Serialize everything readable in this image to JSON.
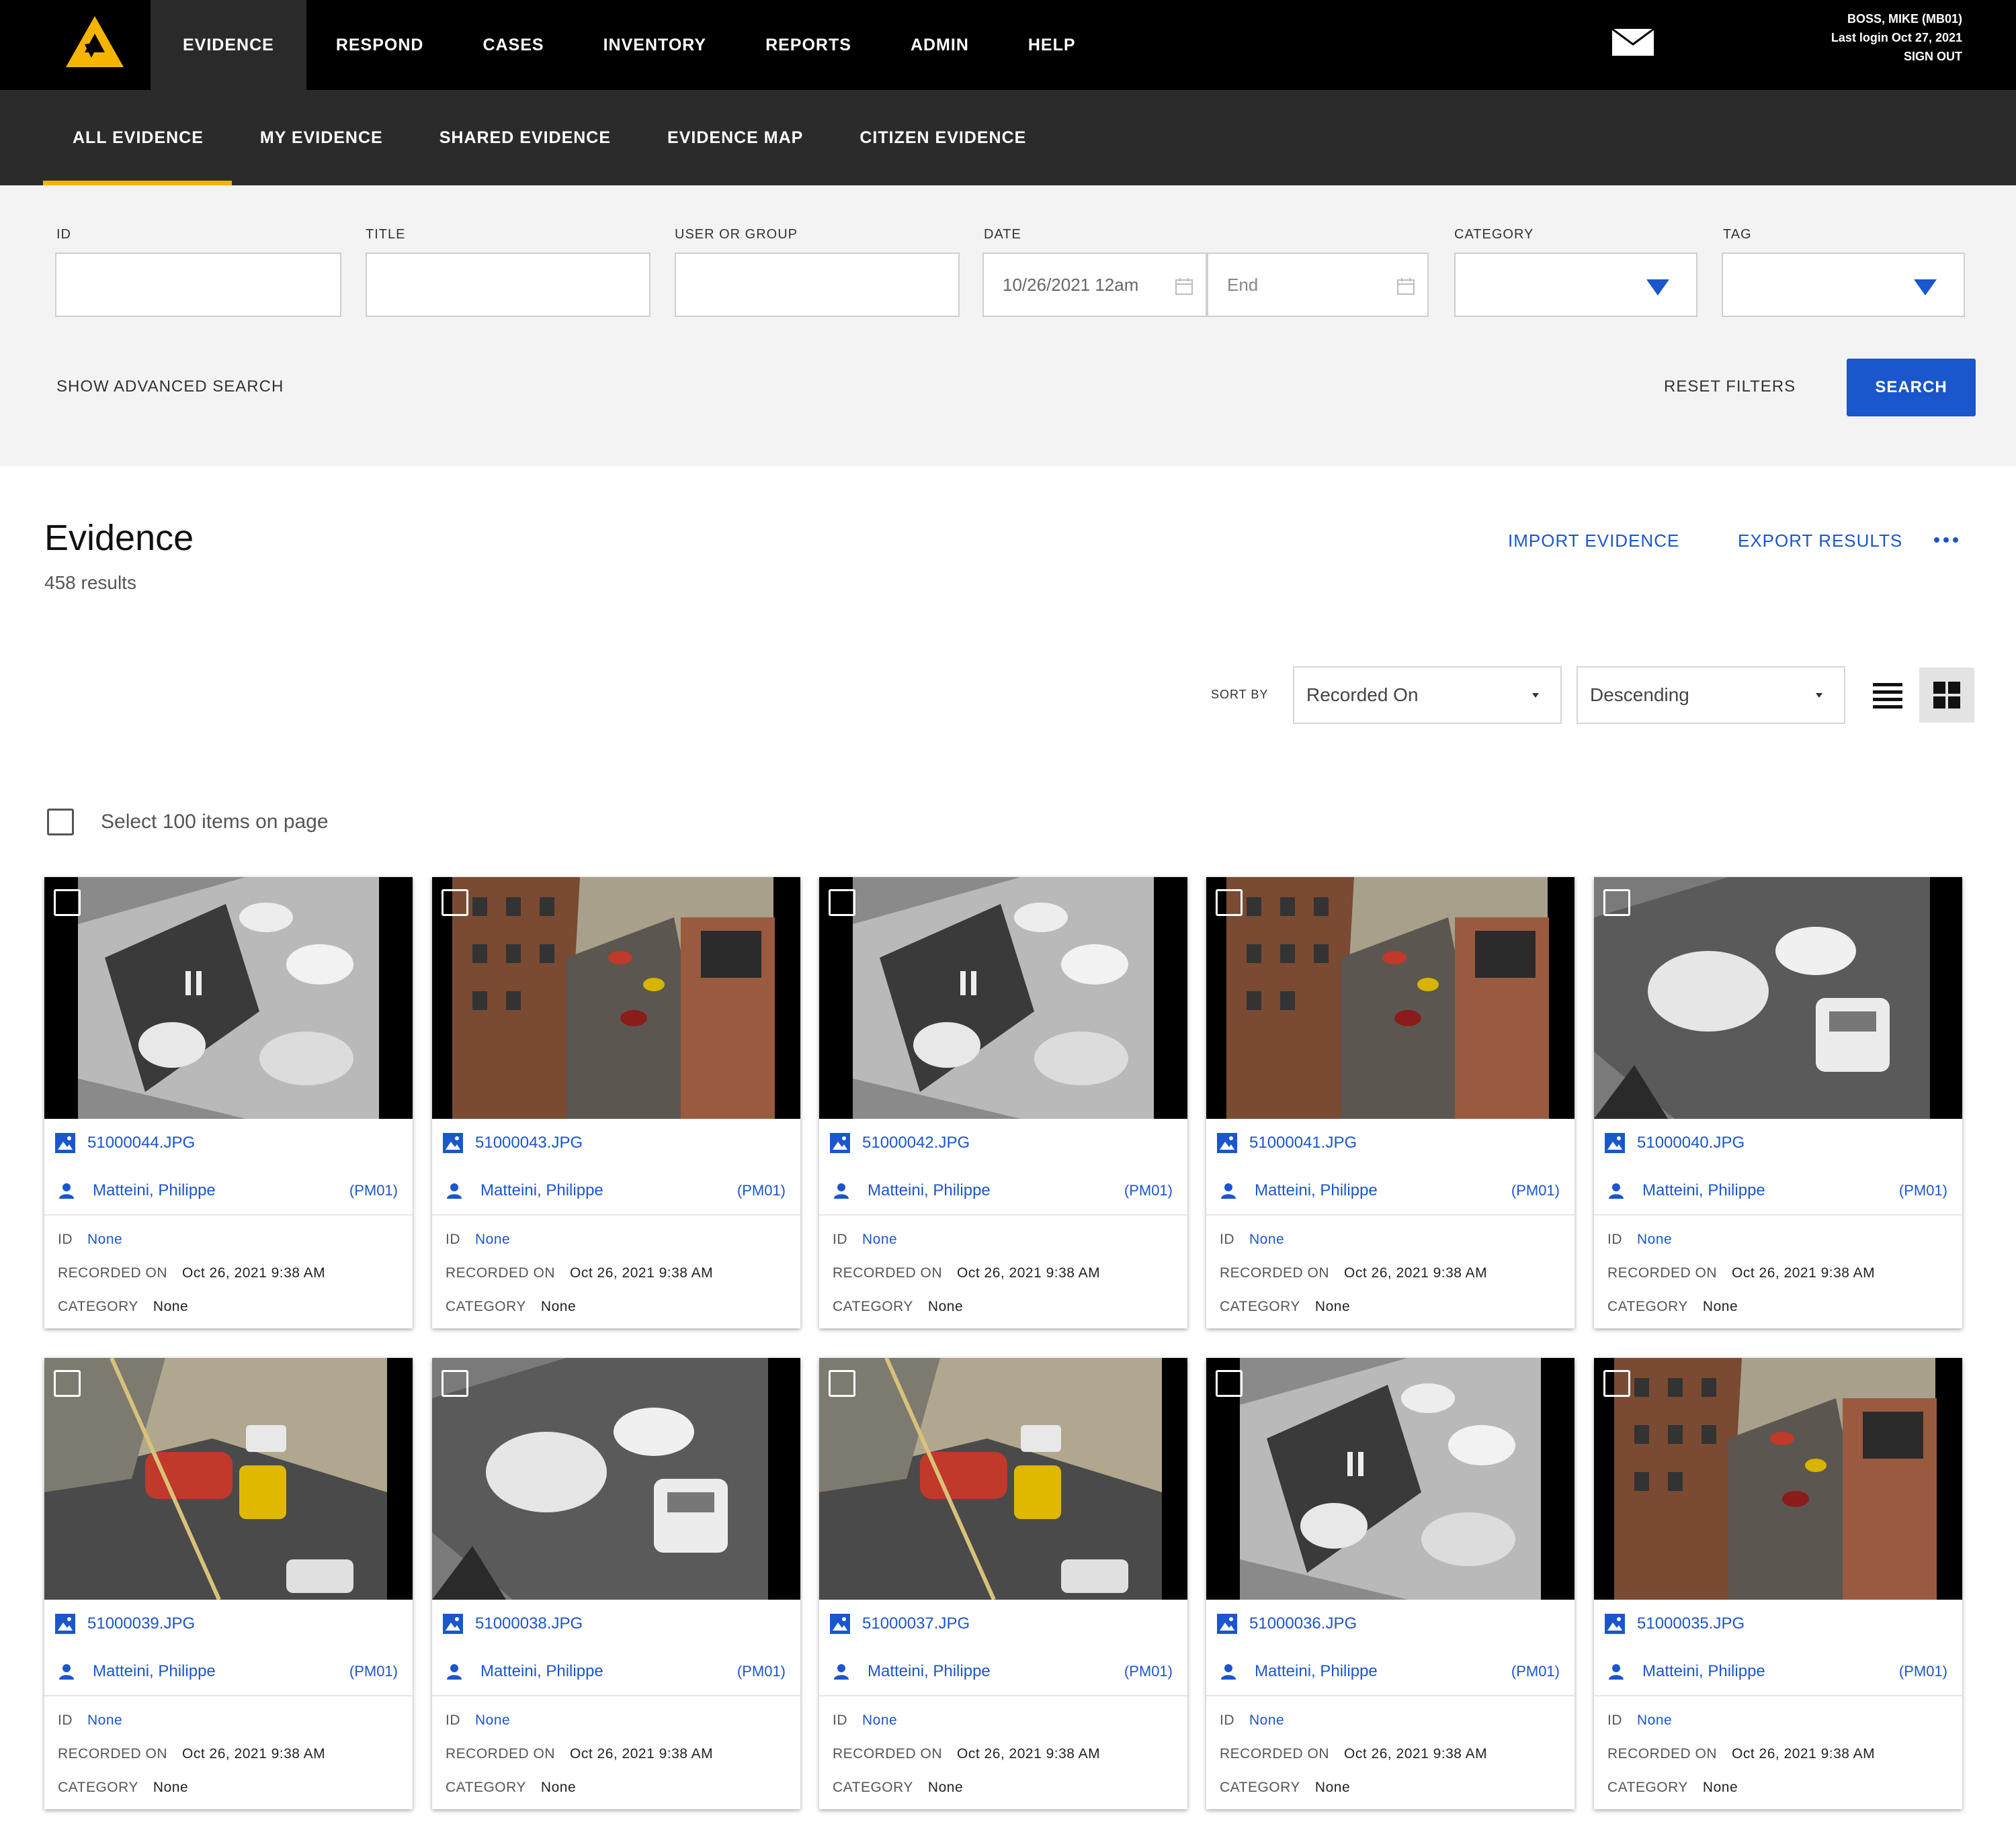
{
  "topnav": {
    "items": [
      "EVIDENCE",
      "RESPOND",
      "CASES",
      "INVENTORY",
      "REPORTS",
      "ADMIN",
      "HELP"
    ],
    "active_index": 0
  },
  "user": {
    "name": "BOSS, MIKE (MB01)",
    "last_login": "Last login Oct 27, 2021",
    "signout": "SIGN OUT"
  },
  "subnav": {
    "items": [
      "ALL EVIDENCE",
      "MY EVIDENCE",
      "SHARED EVIDENCE",
      "EVIDENCE MAP",
      "CITIZEN EVIDENCE"
    ],
    "active_index": 0
  },
  "filters": {
    "id_label": "ID",
    "title_label": "TITLE",
    "user_label": "USER OR GROUP",
    "date_label": "DATE",
    "date_start": "10/26/2021 12am",
    "date_end_placeholder": "End",
    "category_label": "CATEGORY",
    "tag_label": "TAG",
    "advanced": "SHOW ADVANCED SEARCH",
    "reset": "RESET FILTERS",
    "search": "SEARCH"
  },
  "header": {
    "title": "Evidence",
    "count": "458 results",
    "import": "IMPORT EVIDENCE",
    "export": "EXPORT RESULTS"
  },
  "sort": {
    "label": "SORT BY",
    "field": "Recorded On",
    "order": "Descending"
  },
  "select_all": "Select 100 items on page",
  "meta_labels": {
    "id": "ID",
    "recorded": "RECORDED ON",
    "category": "CATEGORY"
  },
  "cards": [
    {
      "file": "51000044.JPG",
      "owner": "Matteini, Philippe",
      "code": "(PM01)",
      "id": "None",
      "recorded": "Oct 26, 2021 9:38 AM",
      "category": "None",
      "scene": "thermal-street"
    },
    {
      "file": "51000043.JPG",
      "owner": "Matteini, Philippe",
      "code": "(PM01)",
      "id": "None",
      "recorded": "Oct 26, 2021 9:38 AM",
      "category": "None",
      "scene": "color-buildings"
    },
    {
      "file": "51000042.JPG",
      "owner": "Matteini, Philippe",
      "code": "(PM01)",
      "id": "None",
      "recorded": "Oct 26, 2021 9:38 AM",
      "category": "None",
      "scene": "thermal-street"
    },
    {
      "file": "51000041.JPG",
      "owner": "Matteini, Philippe",
      "code": "(PM01)",
      "id": "None",
      "recorded": "Oct 26, 2021 9:38 AM",
      "category": "None",
      "scene": "color-buildings"
    },
    {
      "file": "51000040.JPG",
      "owner": "Matteini, Philippe",
      "code": "(PM01)",
      "id": "None",
      "recorded": "Oct 26, 2021 9:38 AM",
      "category": "None",
      "scene": "thermal-crash"
    },
    {
      "file": "51000039.JPG",
      "owner": "Matteini, Philippe",
      "code": "(PM01)",
      "id": "None",
      "recorded": "Oct 26, 2021 9:38 AM",
      "category": "None",
      "scene": "color-crash"
    },
    {
      "file": "51000038.JPG",
      "owner": "Matteini, Philippe",
      "code": "(PM01)",
      "id": "None",
      "recorded": "Oct 26, 2021 9:38 AM",
      "category": "None",
      "scene": "thermal-crash"
    },
    {
      "file": "51000037.JPG",
      "owner": "Matteini, Philippe",
      "code": "(PM01)",
      "id": "None",
      "recorded": "Oct 26, 2021 9:38 AM",
      "category": "None",
      "scene": "color-crash"
    },
    {
      "file": "51000036.JPG",
      "owner": "Matteini, Philippe",
      "code": "(PM01)",
      "id": "None",
      "recorded": "Oct 26, 2021 9:38 AM",
      "category": "None",
      "scene": "thermal-street"
    },
    {
      "file": "51000035.JPG",
      "owner": "Matteini, Philippe",
      "code": "(PM01)",
      "id": "None",
      "recorded": "Oct 26, 2021 9:38 AM",
      "category": "None",
      "scene": "color-buildings"
    }
  ],
  "colors": {
    "accent": "#1a56cc",
    "nav_bg": "#000000",
    "subnav_bg": "#2b2b2b",
    "tab_underline": "#f4b400"
  }
}
